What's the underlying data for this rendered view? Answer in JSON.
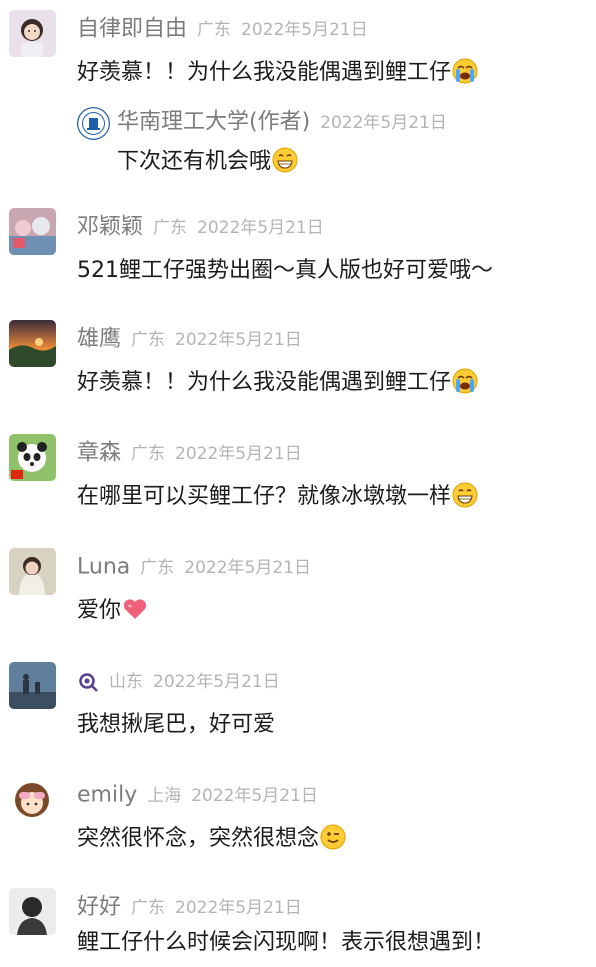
{
  "comments": [
    {
      "name": "自律即自由",
      "location": "广东",
      "date": "2022年5月21日",
      "text": "好羡慕！！为什么我没能偶遇到鲤工仔",
      "emoji": "loudly-crying-face",
      "avatar": "girl-avatar",
      "reply": {
        "name": "华南理工大学(作者)",
        "date": "2022年5月21日",
        "text": "下次还有机会哦",
        "emoji": "grinning-face",
        "avatar": "university-logo-avatar"
      }
    },
    {
      "name": "邓颖颖",
      "location": "广东",
      "date": "2022年5月21日",
      "text": "521鲤工仔强势出圈～真人版也好可爱哦～",
      "avatar": "cartoon-crowd-avatar"
    },
    {
      "name": "雄鹰",
      "location": "广东",
      "date": "2022年5月21日",
      "text": "好羡慕！！为什么我没能偶遇到鲤工仔",
      "emoji": "loudly-crying-face",
      "avatar": "sunset-landscape-avatar"
    },
    {
      "name": "章森",
      "location": "广东",
      "date": "2022年5月21日",
      "text": "在哪里可以买鲤工仔？就像冰墩墩一样",
      "emoji": "grinning-face",
      "avatar": "panda-avatar"
    },
    {
      "name": "Luna",
      "location": "广东",
      "date": "2022年5月21日",
      "text": "爱你",
      "emoji": "pink-heart",
      "avatar": "woman-portrait-avatar"
    },
    {
      "name": "",
      "name_icon": "magnifier-badge-icon",
      "location": "山东",
      "date": "2022年5月21日",
      "text": "我想揪尾巴，好可爱",
      "avatar": "blue-street-avatar"
    },
    {
      "name": "emily",
      "location": "上海",
      "date": "2022年5月21日",
      "text": "突然很怀念，突然很想念",
      "emoji": "winking-face",
      "avatar": "cartoon-girl-avatar"
    },
    {
      "name": "好好",
      "location": "广东",
      "date": "2022年5月21日",
      "text": "鲤工仔什么时候会闪现啊！表示很想遇到！",
      "avatar": "bw-portrait-avatar"
    }
  ],
  "colors": {
    "name": "#7c7c7c",
    "meta": "#b4b4b4",
    "text": "#1c1c1c"
  }
}
